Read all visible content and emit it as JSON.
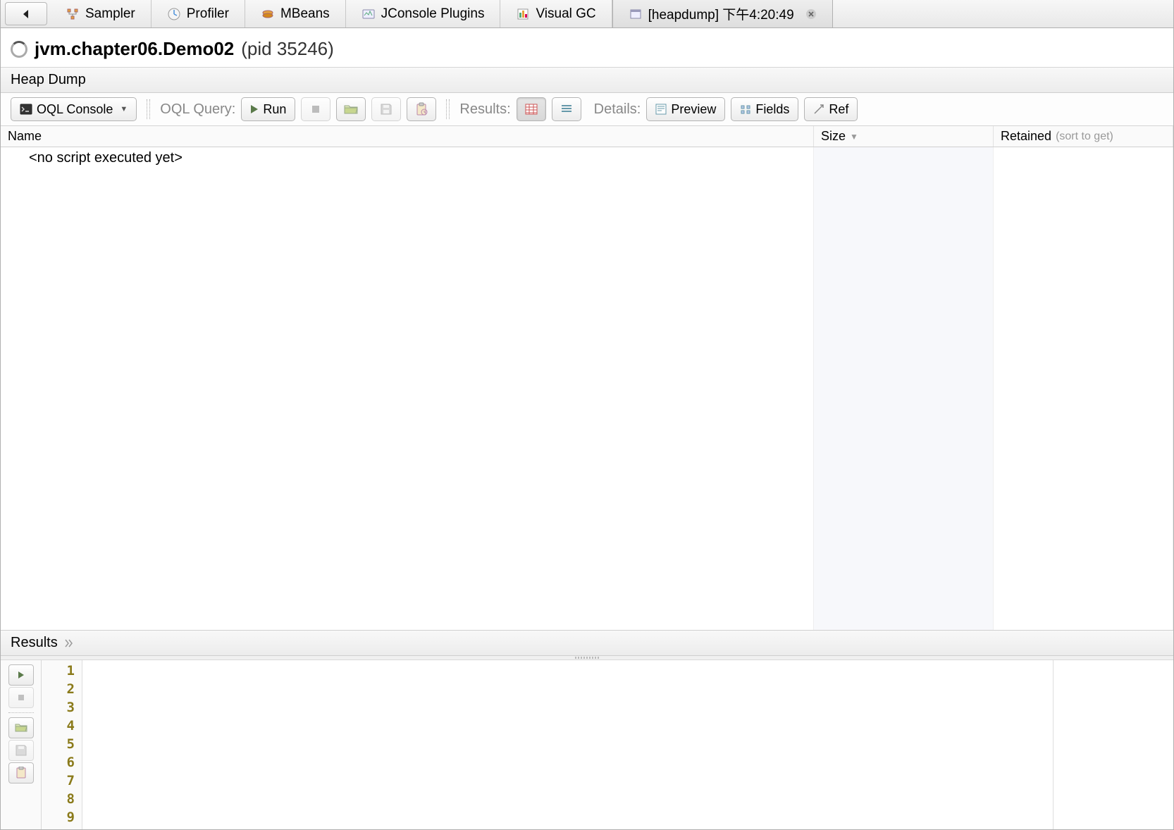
{
  "tabs": [
    {
      "label": "Sampler"
    },
    {
      "label": "Profiler"
    },
    {
      "label": "MBeans"
    },
    {
      "label": "JConsole Plugins"
    },
    {
      "label": "Visual GC"
    },
    {
      "label": "[heapdump] 下午4:20:49",
      "active": true,
      "closable": true
    }
  ],
  "title": {
    "main": "jvm.chapter06.Demo02",
    "sub": "(pid 35246)"
  },
  "section_header": "Heap Dump",
  "toolbar": {
    "oql_console": "OQL Console",
    "query_label": "OQL Query:",
    "run": "Run",
    "results_label": "Results:",
    "details_label": "Details:",
    "preview": "Preview",
    "fields": "Fields",
    "references": "Ref"
  },
  "columns": {
    "name": "Name",
    "size": "Size",
    "retained": "Retained",
    "retained_hint": "(sort to get)"
  },
  "results_body": {
    "placeholder": "<no script executed yet>"
  },
  "lower_header": "Results",
  "editor": {
    "line_numbers": [
      1,
      2,
      3,
      4,
      5,
      6,
      7,
      8,
      9
    ]
  }
}
